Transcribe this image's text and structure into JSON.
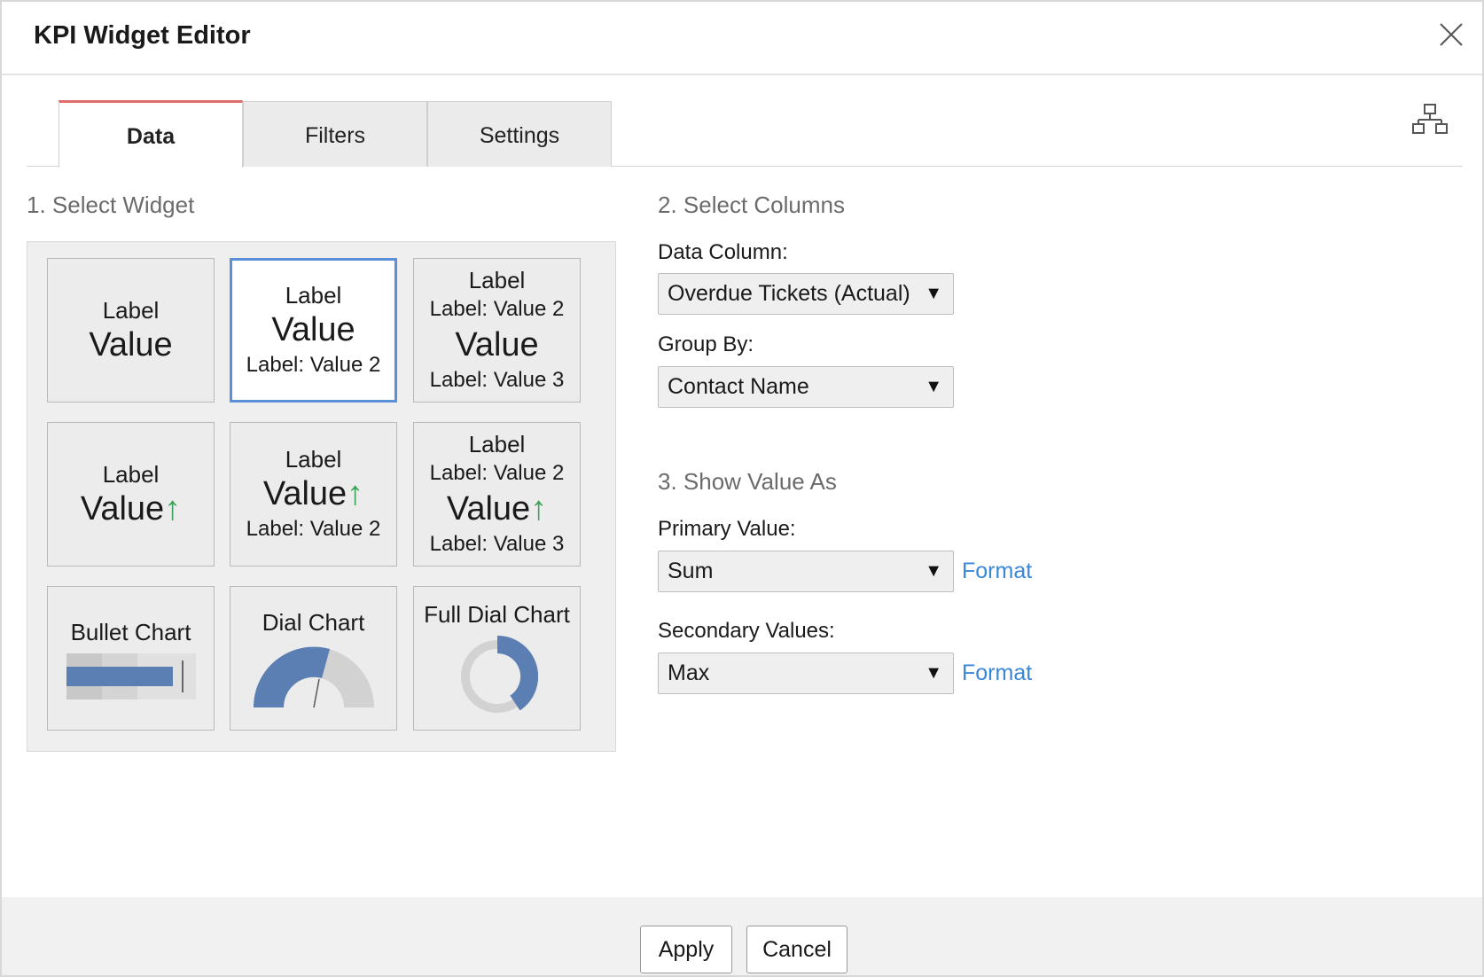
{
  "dialog": {
    "title": "KPI Widget Editor"
  },
  "tabs": [
    {
      "label": "Data",
      "active": true
    },
    {
      "label": "Filters",
      "active": false
    },
    {
      "label": "Settings",
      "active": false
    }
  ],
  "widget_section": {
    "heading": "1. Select Widget",
    "widgets": {
      "w1": {
        "label": "Label",
        "value": "Value"
      },
      "w2": {
        "label": "Label",
        "value": "Value",
        "sub1": "Label: Value 2"
      },
      "w3": {
        "label": "Label",
        "sub1": "Label: Value 2",
        "value": "Value",
        "sub2": "Label: Value 3"
      },
      "w4": {
        "label": "Label",
        "value": "Value",
        "arrow": "↑"
      },
      "w5": {
        "label": "Label",
        "value": "Value",
        "arrow": "↑",
        "sub1": "Label: Value 2"
      },
      "w6": {
        "label": "Label",
        "sub1": "Label: Value 2",
        "value": "Value",
        "arrow": "↑",
        "sub2": "Label: Value 3"
      },
      "w7": {
        "title": "Bullet Chart"
      },
      "w8": {
        "title": "Dial Chart"
      },
      "w9": {
        "title": "Full Dial Chart"
      }
    }
  },
  "columns_section": {
    "heading": "2. Select Columns",
    "data_column_label": "Data Column:",
    "data_column_value": "Overdue Tickets (Actual)",
    "group_by_label": "Group By:",
    "group_by_value": "Contact Name"
  },
  "value_section": {
    "heading": "3. Show Value As",
    "primary_label": "Primary Value:",
    "primary_value": "Sum",
    "secondary_label": "Secondary Values:",
    "secondary_value": "Max",
    "format_label": "Format"
  },
  "footer": {
    "apply_label": "Apply",
    "cancel_label": "Cancel"
  },
  "colors": {
    "accent_tab": "#e06c6c",
    "selected_border": "#5b8fd9",
    "chart_blue": "#5b7fb3",
    "trend_green": "#3aa35a",
    "link_blue": "#3a86d8"
  }
}
